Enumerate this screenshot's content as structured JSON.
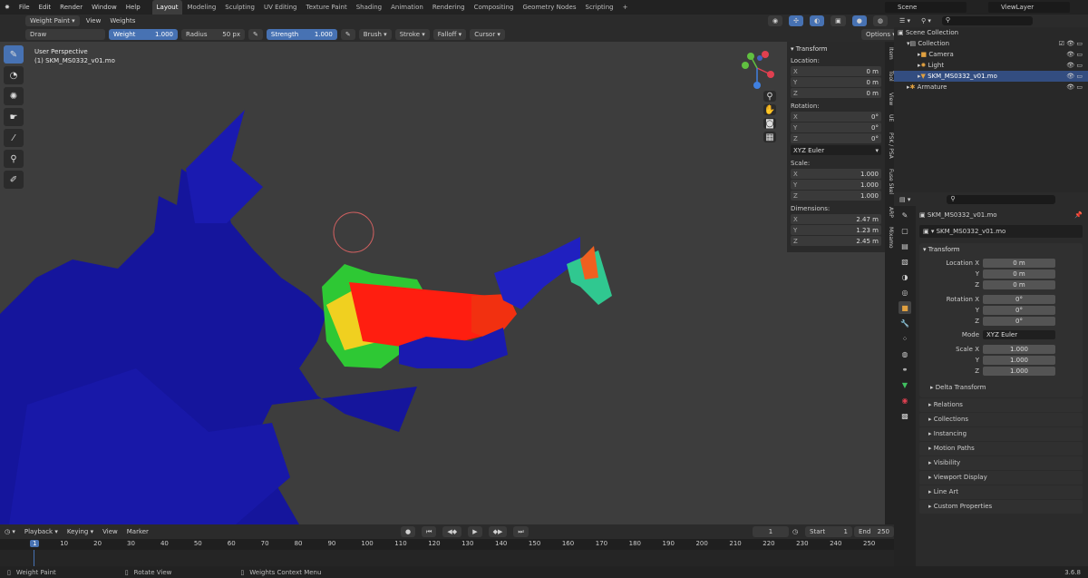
{
  "menu": [
    "File",
    "Edit",
    "Render",
    "Window",
    "Help"
  ],
  "workspaces": [
    "Layout",
    "Modeling",
    "Sculpting",
    "UV Editing",
    "Texture Paint",
    "Shading",
    "Animation",
    "Rendering",
    "Compositing",
    "Geometry Nodes",
    "Scripting"
  ],
  "active_workspace": "Layout",
  "scene": "Scene",
  "view_layer": "ViewLayer",
  "viewport_header": {
    "mode": "Weight Paint",
    "view": "View",
    "weights": "Weights"
  },
  "toolbar": {
    "brush": "Draw",
    "weight_label": "Weight",
    "weight": "1.000",
    "radius_label": "Radius",
    "radius": "50 px",
    "strength_label": "Strength",
    "strength": "1.000",
    "brush_menu": "Brush",
    "stroke": "Stroke",
    "falloff": "Falloff",
    "cursor": "Cursor",
    "options": "Options"
  },
  "overlay_text": {
    "line1": "User Perspective",
    "line2": "(1) SKM_MS0332_v01.mo"
  },
  "npanel": {
    "title": "Transform",
    "location_label": "Location:",
    "location": [
      "0 m",
      "0 m",
      "0 m"
    ],
    "rotation_label": "Rotation:",
    "rotation": [
      "0°",
      "0°",
      "0°"
    ],
    "rotation_mode": "XYZ Euler",
    "scale_label": "Scale:",
    "scale": [
      "1.000",
      "1.000",
      "1.000"
    ],
    "dimensions_label": "Dimensions:",
    "dimensions": [
      "2.47 m",
      "1.23 m",
      "2.45 m"
    ],
    "axes": [
      "X",
      "Y",
      "Z"
    ]
  },
  "side_tabs": [
    "Item",
    "Tool",
    "View",
    "UE",
    "PSK / PSA",
    "Fuse Skel",
    "ARP",
    "Mixamo"
  ],
  "outliner": {
    "root": "Scene Collection",
    "collection": "Collection",
    "items": [
      "Camera",
      "Light",
      "SKM_MS0332_v01.mo"
    ],
    "armature": "Armature"
  },
  "properties": {
    "object_name": "SKM_MS0332_v01.mo",
    "mesh_name": "SKM_MS0332_v01.mo",
    "transform_title": "Transform",
    "location_x_label": "Location X",
    "rotation_x_label": "Rotation X",
    "scale_x_label": "Scale X",
    "y_label": "Y",
    "z_label": "Z",
    "mode_label": "Mode",
    "location": [
      "0 m",
      "0 m",
      "0 m"
    ],
    "rotation": [
      "0°",
      "0°",
      "0°"
    ],
    "mode": "XYZ Euler",
    "scale": [
      "1.000",
      "1.000",
      "1.000"
    ],
    "delta": "Delta Transform",
    "panels": [
      "Relations",
      "Collections",
      "Instancing",
      "Motion Paths",
      "Visibility",
      "Viewport Display",
      "Line Art",
      "Custom Properties"
    ]
  },
  "timeline": {
    "menus": [
      "Playback",
      "Keying",
      "View",
      "Marker"
    ],
    "current_frame": "1",
    "start_label": "Start",
    "start": "1",
    "end_label": "End",
    "end": "250",
    "ticks": [
      "1",
      "10",
      "20",
      "30",
      "40",
      "50",
      "60",
      "70",
      "80",
      "90",
      "100",
      "110",
      "120",
      "130",
      "140",
      "150",
      "160",
      "170",
      "180",
      "190",
      "200",
      "210",
      "220",
      "230",
      "240",
      "250"
    ]
  },
  "status": {
    "left": "Weight Paint",
    "mid": "Rotate View",
    "right": "Weights Context Menu",
    "version": "3.6.8"
  },
  "colors": {
    "accent": "#4772b3",
    "bg": "#3d3d3d",
    "mesh_blue": "#1a1aa8",
    "weight_red": "#ff2000"
  }
}
